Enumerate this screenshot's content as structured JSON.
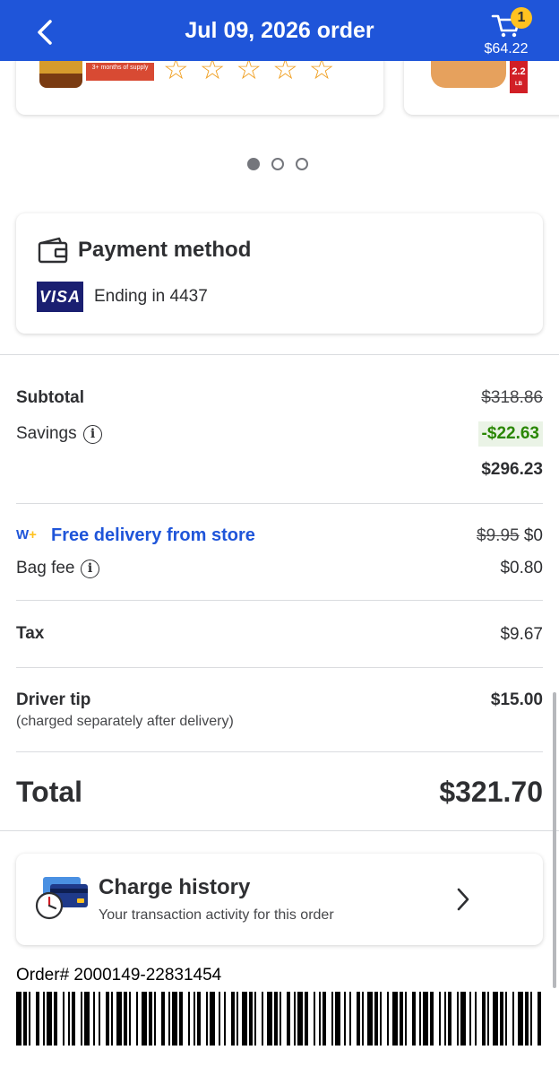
{
  "header": {
    "title": "Jul 09, 2026 order",
    "back_icon": "chevron-left-icon",
    "cart_icon": "cart-icon",
    "cart_count": "1",
    "cart_total": "$64.22",
    "accent": "#1f55d9"
  },
  "carousel": {
    "product_label": "3+ months of supply",
    "weight_tag": "2.2",
    "weight_unit": "LB",
    "rating": "☆☆☆☆☆",
    "pages": 3,
    "active_page": 1
  },
  "payment": {
    "title": "Payment method",
    "icon": "wallet-icon",
    "card_brand": "VISA",
    "ending": "Ending in 4437"
  },
  "summary": {
    "subtotal_label": "Subtotal",
    "subtotal_original": "$318.86",
    "savings_label": "Savings",
    "savings_value": "-$22.63",
    "subtotal_final": "$296.23",
    "delivery_badge": "W+",
    "delivery_label": "Free delivery from store",
    "delivery_original": "$9.95",
    "delivery_price": "$0",
    "bag_fee_label": "Bag fee",
    "bag_fee_value": "$0.80",
    "tax_label": "Tax",
    "tax_value": "$9.67",
    "tip_label": "Driver tip",
    "tip_note": "(charged separately after delivery)",
    "tip_value": "$15.00",
    "total_label": "Total",
    "total_value": "$321.70",
    "savings_color": "#2a8703"
  },
  "charge_history": {
    "title": "Charge history",
    "subtitle": "Your transaction activity for this order",
    "icon": "charge-history-icon"
  },
  "order": {
    "number": "Order# 2000149-22831454"
  }
}
